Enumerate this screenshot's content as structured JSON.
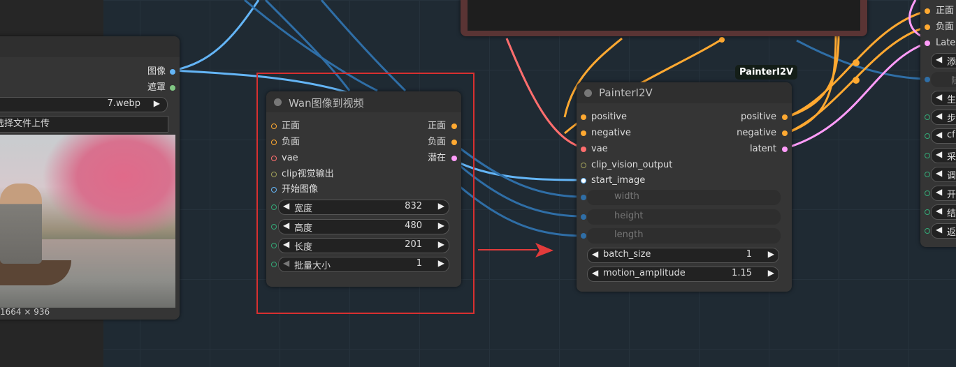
{
  "left_node": {
    "outputs": [
      "图像",
      "遮罩"
    ],
    "file_value": "7.webp",
    "upload_label": "选择文件上传",
    "image_size": "1664 × 936",
    "image_description_icon": "landscape-photo"
  },
  "wan_node": {
    "title": "Wan图像到视频",
    "inputs": [
      "正面",
      "负面",
      "vae",
      "clip视觉输出",
      "开始图像"
    ],
    "outputs": [
      "正面",
      "负面",
      "潜在"
    ],
    "widgets": [
      {
        "label": "宽度",
        "value": "832"
      },
      {
        "label": "高度",
        "value": "480"
      },
      {
        "label": "长度",
        "value": "201"
      },
      {
        "label": "批量大小",
        "value": "1"
      }
    ]
  },
  "painter_node": {
    "badge": "PainterI2V",
    "title": "PainterI2V",
    "inputs": [
      "positive",
      "negative",
      "vae",
      "clip_vision_output",
      "start_image"
    ],
    "outputs": [
      "positive",
      "negative",
      "latent"
    ],
    "converted_inputs": [
      "width",
      "height",
      "length"
    ],
    "widgets": [
      {
        "label": "batch_size",
        "value": "1"
      },
      {
        "label": "motion_amplitude",
        "value": "1.15"
      }
    ]
  },
  "right_node": {
    "inputs": [
      "正面",
      "负面",
      "Laten"
    ],
    "widgets": [
      "添",
      "随",
      "生",
      "步",
      "cf",
      "采",
      "调",
      "开",
      "结",
      "返"
    ]
  },
  "colors": {
    "image": "#64b5f6",
    "mask": "#81c784",
    "conditioning": "#ffa931",
    "vae": "#ff6e6e",
    "latent": "#ff9cf9",
    "clip_vision": "#a1a15a",
    "highlight": "#d83030"
  }
}
